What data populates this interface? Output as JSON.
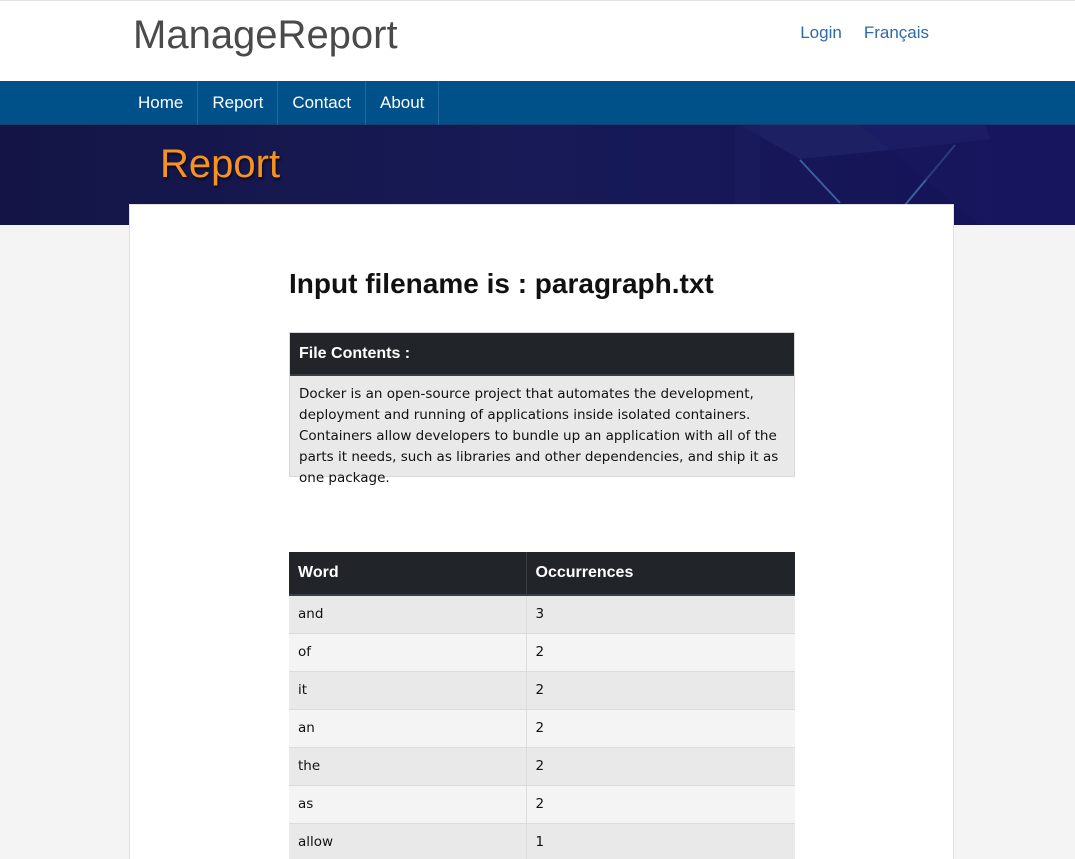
{
  "header": {
    "brand": "ManageReport",
    "links": [
      {
        "label": "Login"
      },
      {
        "label": "Français"
      }
    ]
  },
  "nav": {
    "items": [
      {
        "label": "Home"
      },
      {
        "label": "Report"
      },
      {
        "label": "Contact"
      },
      {
        "label": "About"
      }
    ]
  },
  "banner": {
    "title": "Report"
  },
  "main": {
    "heading": "Input filename is : paragraph.txt",
    "file_contents": {
      "header": "File Contents :",
      "text": "Docker is an open-source project that automates the development, deployment and running of applications inside isolated containers. Containers allow developers to bundle up an application with all of the parts it needs, such as libraries and other dependencies, and ship it as one package."
    },
    "word_table": {
      "columns": [
        "Word",
        "Occurrences"
      ],
      "rows": [
        {
          "word": "and",
          "count": "3"
        },
        {
          "word": "of",
          "count": "2"
        },
        {
          "word": "it",
          "count": "2"
        },
        {
          "word": "an",
          "count": "2"
        },
        {
          "word": "the",
          "count": "2"
        },
        {
          "word": "as",
          "count": "2"
        },
        {
          "word": "allow",
          "count": "1"
        }
      ]
    }
  },
  "colors": {
    "navbar": "#00508a",
    "banner": "#141546",
    "banner_title": "#f7931e",
    "table_header": "#212529",
    "link": "#2c6aa8"
  }
}
